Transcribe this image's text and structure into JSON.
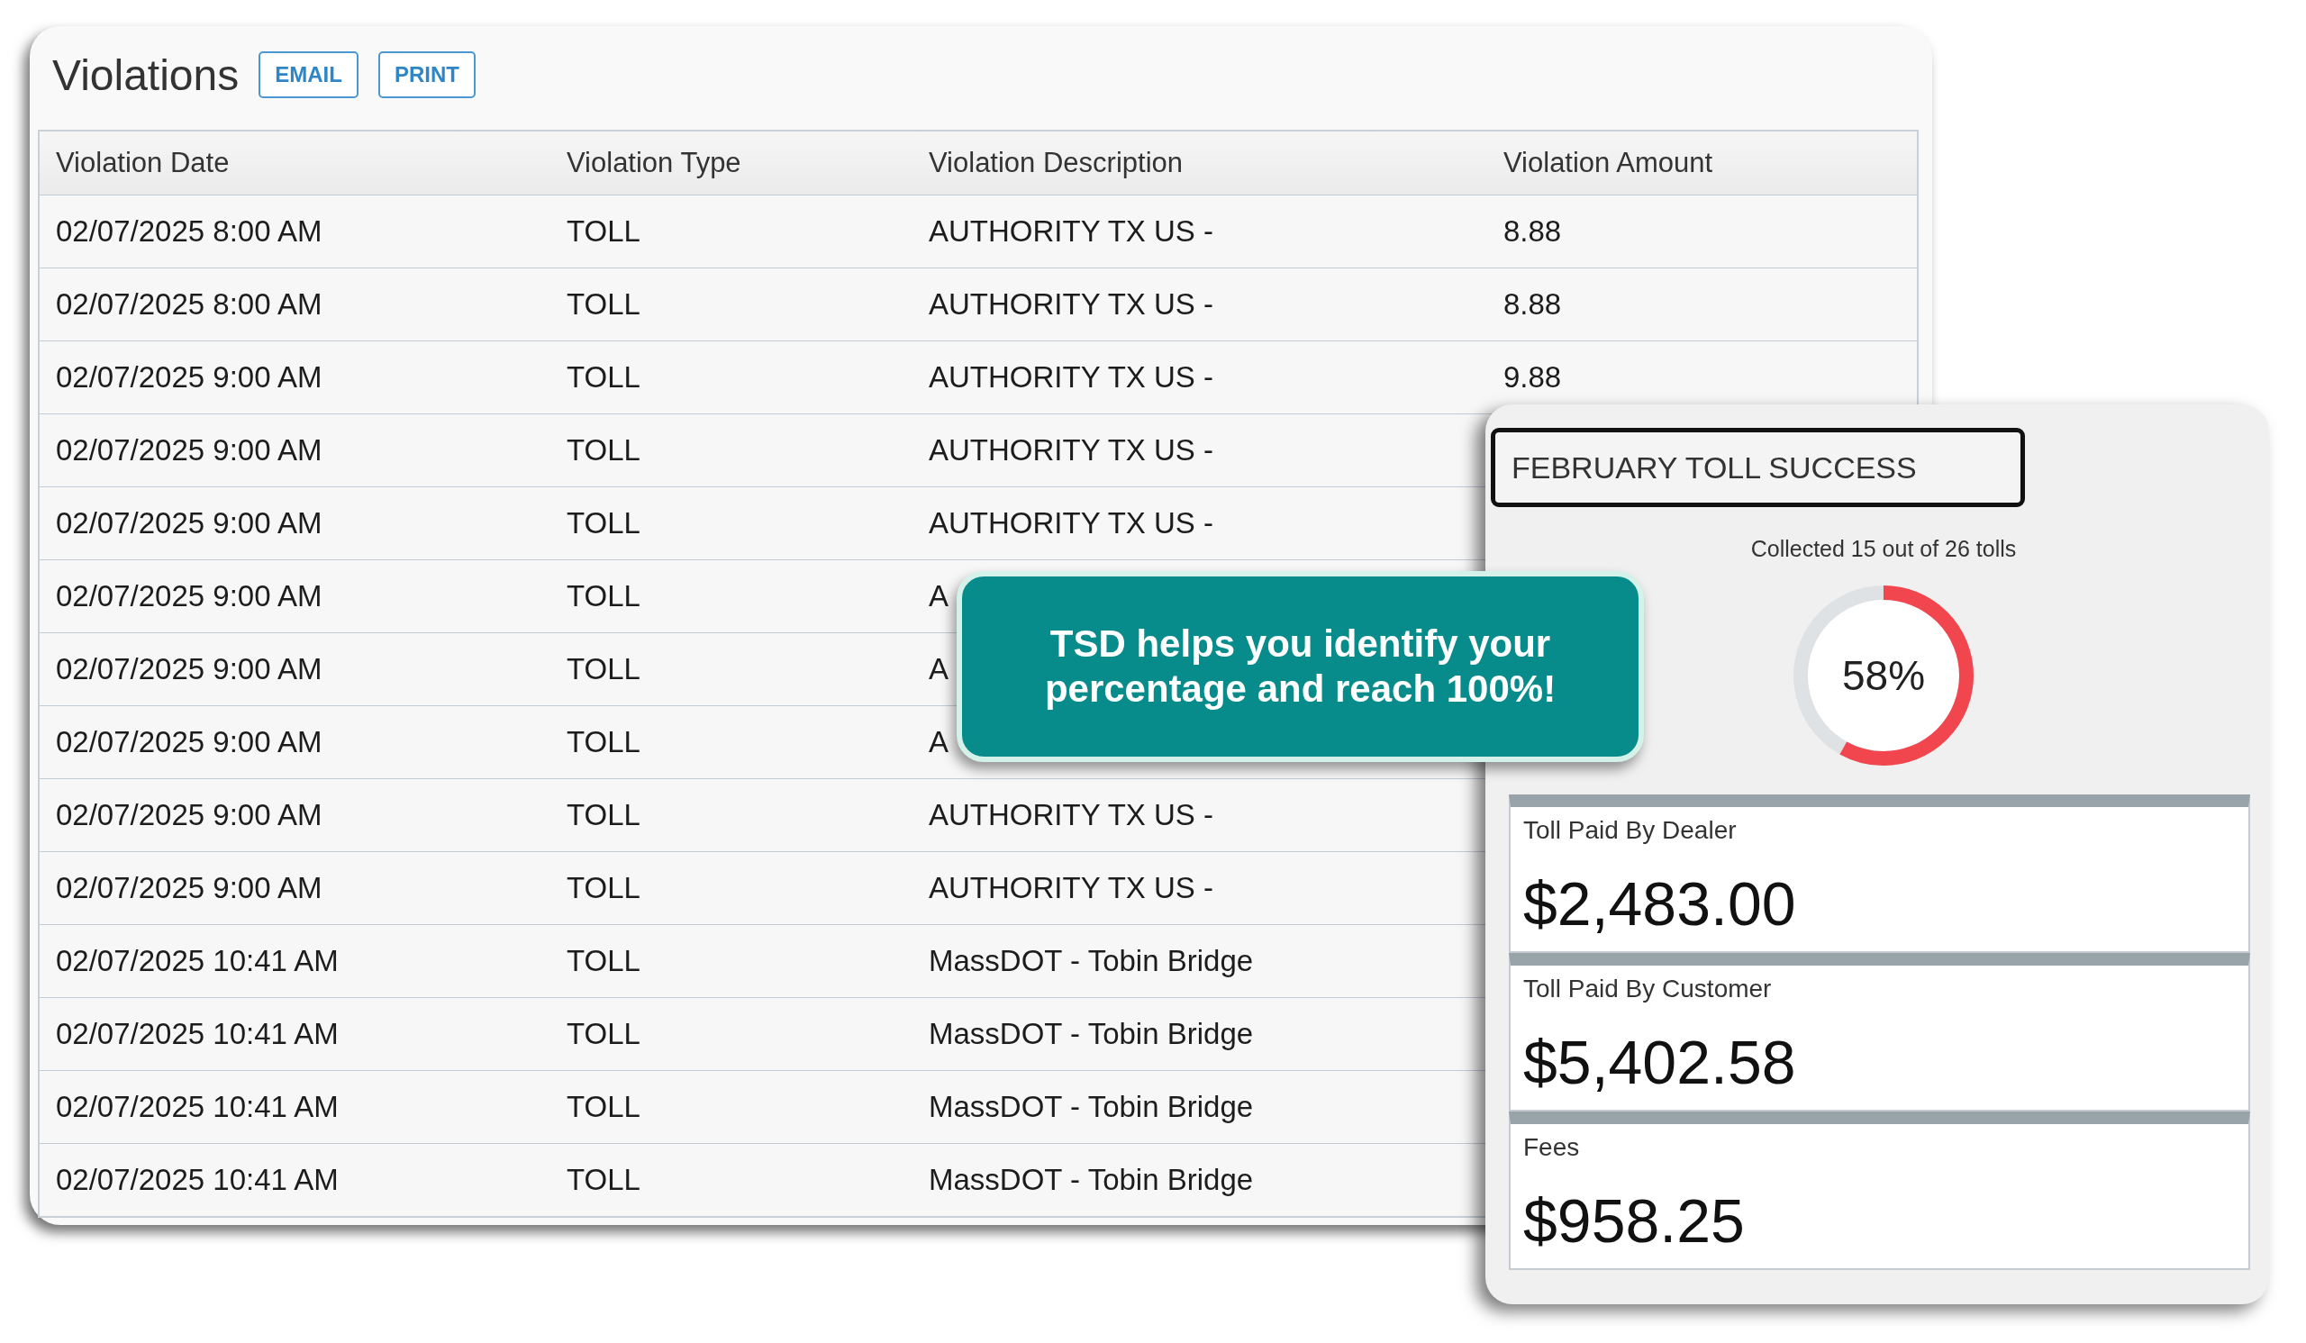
{
  "panel": {
    "title": "Violations",
    "buttons": [
      "EMAIL",
      "PRINT"
    ],
    "table": {
      "columns": [
        "Violation Date",
        "Violation Type",
        "Violation Description",
        "Violation Amount"
      ],
      "rows": [
        {
          "date": "02/07/2025 8:00 AM",
          "type": "TOLL",
          "description": "AUTHORITY TX US -",
          "amount": "8.88"
        },
        {
          "date": "02/07/2025 8:00 AM",
          "type": "TOLL",
          "description": "AUTHORITY TX US -",
          "amount": "8.88"
        },
        {
          "date": "02/07/2025 9:00 AM",
          "type": "TOLL",
          "description": "AUTHORITY TX US -",
          "amount": "9.88"
        },
        {
          "date": "02/07/2025 9:00 AM",
          "type": "TOLL",
          "description": "AUTHORITY TX US -"
        },
        {
          "date": "02/07/2025 9:00 AM",
          "type": "TOLL",
          "description": "AUTHORITY TX US -"
        },
        {
          "date": "02/07/2025 9:00 AM",
          "type": "TOLL",
          "description": "A"
        },
        {
          "date": "02/07/2025 9:00 AM",
          "type": "TOLL",
          "description": "A"
        },
        {
          "date": "02/07/2025 9:00 AM",
          "type": "TOLL",
          "description": "A"
        },
        {
          "date": "02/07/2025 9:00 AM",
          "type": "TOLL",
          "description": "AUTHORITY TX US -"
        },
        {
          "date": "02/07/2025 9:00 AM",
          "type": "TOLL",
          "description": "AUTHORITY TX US -"
        },
        {
          "date": "02/07/2025 10:41 AM",
          "type": "TOLL",
          "description": "MassDOT - Tobin Bridge"
        },
        {
          "date": "02/07/2025 10:41 AM",
          "type": "TOLL",
          "description": "MassDOT - Tobin Bridge"
        },
        {
          "date": "02/07/2025 10:41 AM",
          "type": "TOLL",
          "description": "MassDOT - Tobin Bridge"
        },
        {
          "date": "02/07/2025 10:41 AM",
          "type": "TOLL",
          "description": "MassDOT - Tobin Bridge"
        }
      ]
    }
  },
  "callout": {
    "text": "TSD helps you identify your percentage and reach 100%!"
  },
  "summary": {
    "title": "FEBRUARY TOLL SUCCESS",
    "caption": "Collected 15 out of 26 tolls",
    "percent": "58%",
    "stats": [
      {
        "label": "Toll Paid By Dealer",
        "value": "$2,483.00"
      },
      {
        "label": "Toll Paid By Customer",
        "value": "$5,402.58"
      },
      {
        "label": "Fees",
        "value": "$958.25"
      }
    ]
  }
}
